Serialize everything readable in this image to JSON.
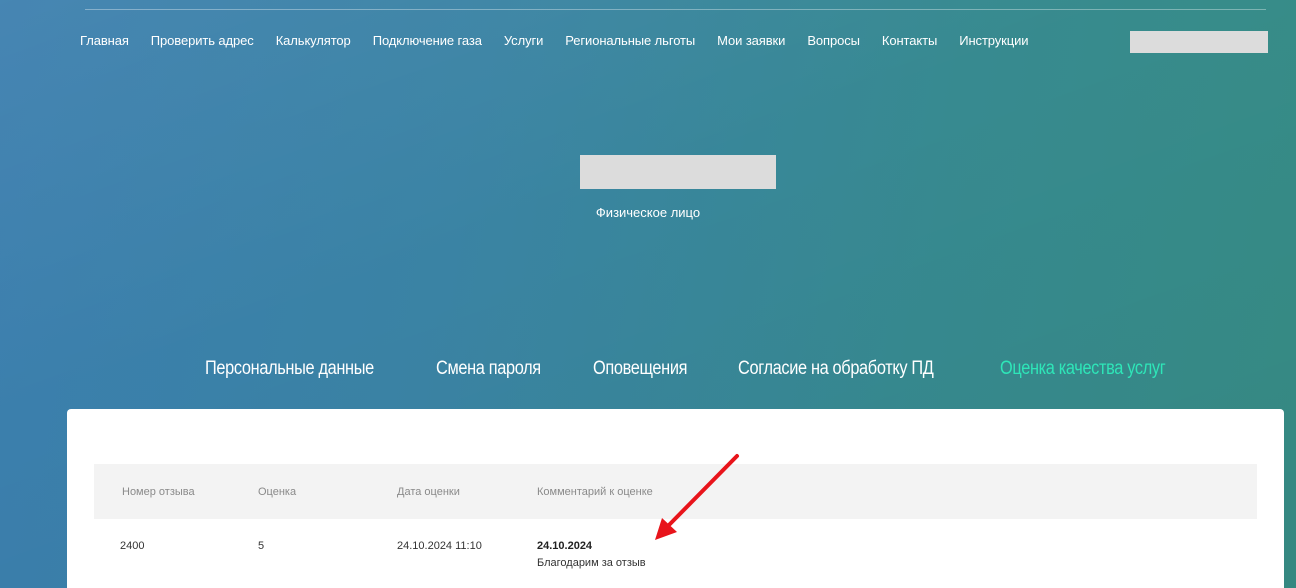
{
  "nav": {
    "items": [
      "Главная",
      "Проверить адрес",
      "Калькулятор",
      "Подключение газа",
      "Услуги",
      "Региональные льготы",
      "Мои заявки",
      "Вопросы",
      "Контакты",
      "Инструкции"
    ]
  },
  "profile": {
    "user_type": "Физическое лицо"
  },
  "tabs": {
    "items": [
      "Персональные данные",
      "Смена пароля",
      "Оповещения",
      "Согласие на обработку ПД",
      "Оценка качества услуг"
    ],
    "active_index": 4
  },
  "table": {
    "headers": [
      "Номер отзыва",
      "Оценка",
      "Дата оценки",
      "Комментарий к оценке"
    ],
    "rows": [
      {
        "id": "2400",
        "rating": "5",
        "date": "24.10.2024 11:10",
        "comment_date": "24.10.2024",
        "comment_text": "Благодарим за отзыв"
      }
    ]
  },
  "colors": {
    "active_tab": "#2ee6b8",
    "annotation_arrow": "#e8141b",
    "redaction": "#dcdcdc"
  }
}
